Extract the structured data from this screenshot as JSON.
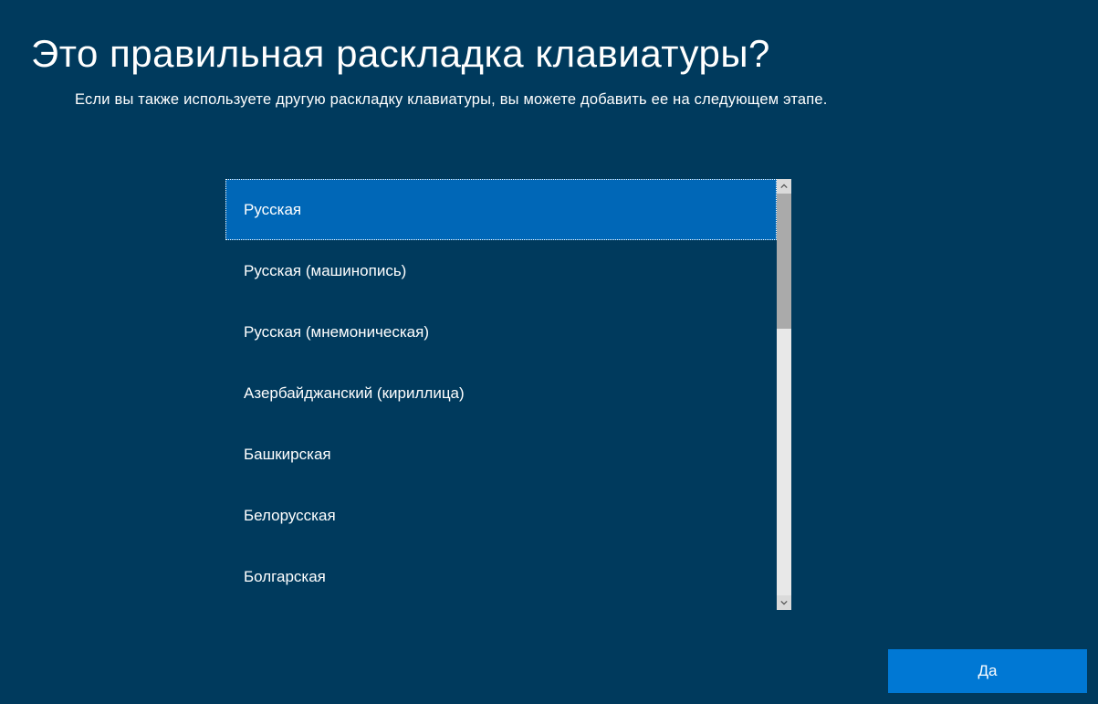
{
  "header": {
    "title": "Это правильная раскладка клавиатуры?",
    "subtitle": "Если вы также используете другую раскладку клавиатуры, вы можете добавить ее на следующем этапе."
  },
  "layouts": {
    "items": [
      {
        "label": "Русская",
        "selected": true
      },
      {
        "label": "Русская (машинопись)",
        "selected": false
      },
      {
        "label": "Русская (мнемоническая)",
        "selected": false
      },
      {
        "label": "Азербайджанский (кириллица)",
        "selected": false
      },
      {
        "label": "Башкирская",
        "selected": false
      },
      {
        "label": "Белорусская",
        "selected": false
      },
      {
        "label": "Болгарская",
        "selected": false
      }
    ]
  },
  "actions": {
    "confirm_label": "Да"
  },
  "colors": {
    "background": "#003a5d",
    "accent": "#0078d4",
    "list_selected": "#0067b7",
    "text": "#ffffff"
  }
}
